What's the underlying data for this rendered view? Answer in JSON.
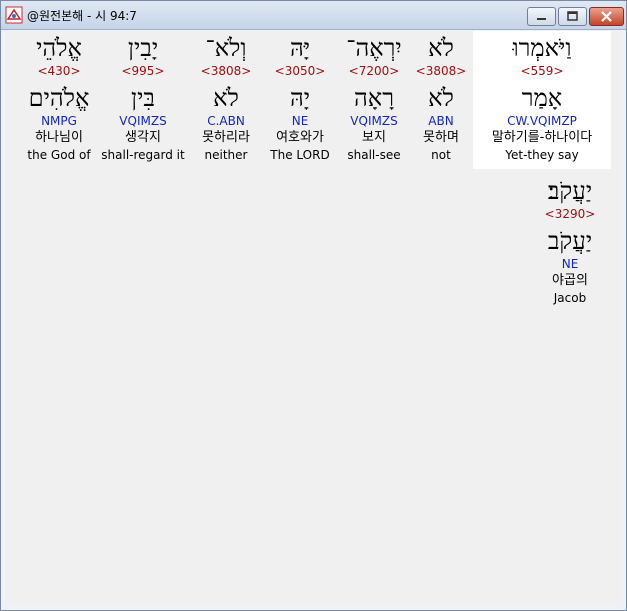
{
  "window": {
    "title": "@원전본해 - 시 94:7",
    "icon": "app-icon",
    "buttons": [
      "minimize-icon",
      "maximize-icon",
      "close-icon"
    ]
  },
  "row1": [
    {
      "heb": "וַיֹּאמְרוּ",
      "strong": "<559>",
      "lemma": "אָמַר",
      "morph": "CW.VQIMZP",
      "kor": "말하기를-하나이다",
      "eng": "Yet-they say"
    },
    {
      "heb": "לֹא",
      "strong": "<3808>",
      "lemma": "לֹא",
      "morph": "ABN",
      "kor": "못하며",
      "eng": "not"
    },
    {
      "heb": "יִרְאֶה־",
      "strong": "<7200>",
      "lemma": "רָאָה",
      "morph": "VQIMZS",
      "kor": "보지",
      "eng": "shall-see"
    },
    {
      "heb": "יָּהּ",
      "strong": "<3050>",
      "lemma": "יָהּ",
      "morph": "NE",
      "kor": "여호와가",
      "eng": "The LORD"
    },
    {
      "heb": "וְלֹא־",
      "strong": "<3808>",
      "lemma": "לֹא",
      "morph": "C.ABN",
      "kor": "못하리라",
      "eng": "neither"
    },
    {
      "heb": "יָבִין",
      "strong": "<995>",
      "lemma": "בִּין",
      "morph": "VQIMZS",
      "kor": "생각지",
      "eng": "shall-regard it"
    },
    {
      "heb": "אֱלֹהֵי",
      "strong": "<430>",
      "lemma": "אֱלֹהִים",
      "morph": "NMPG",
      "kor": "하나님이",
      "eng": "the God of"
    }
  ],
  "row2": [
    {
      "heb": "יַעֲקֹב׃",
      "strong": "<3290>",
      "lemma": "יַעֲקֹב",
      "morph": "NE",
      "kor": "야곱의",
      "eng": "Jacob"
    }
  ]
}
